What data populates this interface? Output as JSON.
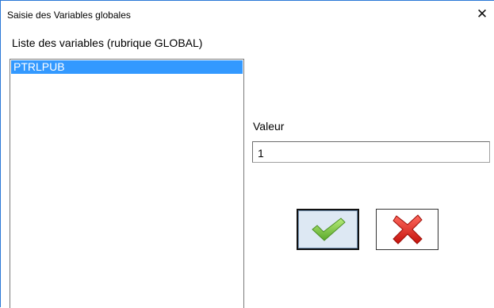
{
  "window": {
    "title": "Saisie des Variables globales",
    "close_glyph": "✕"
  },
  "variables": {
    "label": "Liste des variables (rubrique GLOBAL)",
    "items": [
      "PTRLPUB"
    ],
    "selected_index": 0
  },
  "value": {
    "label": "Valeur",
    "current": "1"
  },
  "buttons": {
    "ok_icon": "checkmark-icon",
    "cancel_icon": "red-x-icon"
  },
  "colors": {
    "selection": "#3399ff",
    "window_border": "#2b79d7",
    "ok_face": "#dde8f3",
    "check_green": "#7ccb3c",
    "cross_red": "#e0201a"
  }
}
